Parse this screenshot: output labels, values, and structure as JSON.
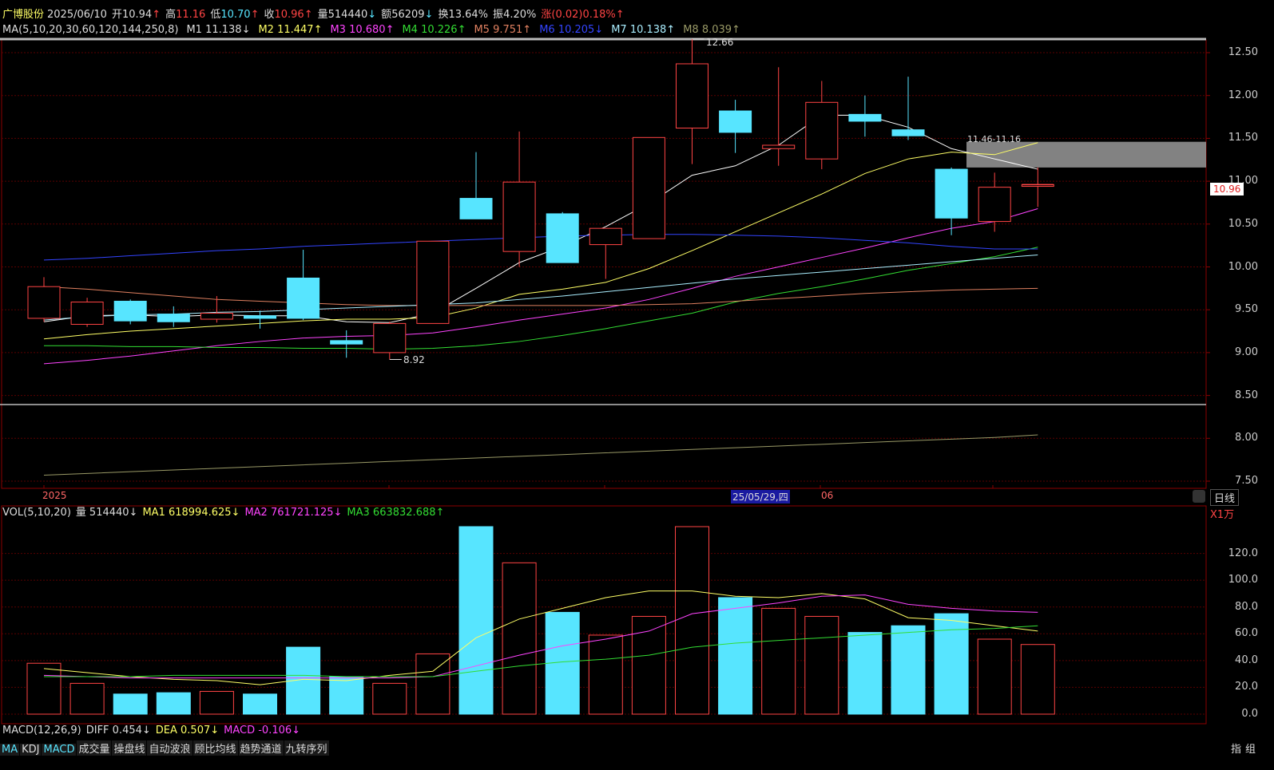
{
  "header": {
    "stock_name": "广博股份",
    "date": "2025/06/10",
    "open_label": "开",
    "open": "10.94",
    "open_arrow": "↑",
    "high_label": "高",
    "high": "11.16",
    "low_label": "低",
    "low": "10.70",
    "low_arrow": "↑",
    "close_label": "收",
    "close": "10.96",
    "close_arrow": "↑",
    "volume_label": "量",
    "volume": "514440",
    "volume_arrow": "↓",
    "amount_label": "额",
    "amount": "56209",
    "amount_arrow": "↓",
    "turnover_label": "换",
    "turnover": "13.64%",
    "amplitude_label": "振",
    "amplitude": "4.20%",
    "change_label": "涨",
    "change": "(0.02)",
    "change_pct": "0.18%",
    "change_arrow": "↑"
  },
  "ma_line": {
    "label": "MA(5,10,20,30,60,120,144,250,8)",
    "items": [
      {
        "name": "M1",
        "value": "11.138↓",
        "color": "#ffffff"
      },
      {
        "name": "M2",
        "value": "11.447↑",
        "color": "#ffff66"
      },
      {
        "name": "M3",
        "value": "10.680↑",
        "color": "#ff44ff"
      },
      {
        "name": "M4",
        "value": "10.226↑",
        "color": "#33dd33"
      },
      {
        "name": "M5",
        "value": "9.751↑",
        "color": "#e08060"
      },
      {
        "name": "M6",
        "value": "10.205↓",
        "color": "#3344ff"
      },
      {
        "name": "M7",
        "value": "10.138↑",
        "color": "#aaeeff"
      },
      {
        "name": "M8",
        "value": "8.039↑",
        "color": "#999966"
      }
    ]
  },
  "price_axis": [
    "12.50",
    "12.00",
    "11.50",
    "11.00",
    "10.50",
    "10.00",
    "9.50",
    "9.00",
    "8.50",
    "8.00",
    "7.50"
  ],
  "current_price_tag": "10.96",
  "annotations": {
    "high": "12.66",
    "low": "8.92",
    "zone": "11.46-11.16"
  },
  "date_labels": {
    "year": "2025",
    "cursor_date": "25/05/29,四",
    "month": "06"
  },
  "right_tools": {
    "period": "日线",
    "vol_unit": "X1万",
    "indicator": "指",
    "group": "组"
  },
  "vol_line": {
    "label": "VOL(5,10,20)",
    "vol_label": "量",
    "vol_value": "514440↓",
    "ma1": "MA1 618994.625↓",
    "ma2": "MA2 761721.125↓",
    "ma3": "MA3 663832.688↑"
  },
  "vol_axis": [
    "120.0",
    "100.0",
    "80.0",
    "60.0",
    "40.0",
    "20.0",
    "0.0"
  ],
  "macd_line": {
    "label": "MACD(12,26,9)",
    "diff": "DIFF 0.454↓",
    "dea": "DEA 0.507↓",
    "macd": "MACD -0.106↓"
  },
  "bottom_tabs": [
    "MA",
    "KDJ",
    "MACD",
    "成交量",
    "操盘线",
    "自动波浪",
    "顾比均线",
    "趋势通道",
    "九转序列"
  ],
  "colors": {
    "up": "#ff4444",
    "down": "#57e5ff",
    "grid": "#6b0000"
  },
  "chart_data": [
    {
      "type": "candlestick",
      "title": "",
      "ylim": [
        7.45,
        12.75
      ],
      "candles": [
        {
          "o": 9.4,
          "h": 9.88,
          "l": 9.36,
          "c": 9.77
        },
        {
          "o": 9.33,
          "h": 9.64,
          "l": 9.3,
          "c": 9.59
        },
        {
          "o": 9.6,
          "h": 9.62,
          "l": 9.33,
          "c": 9.37
        },
        {
          "o": 9.45,
          "h": 9.54,
          "l": 9.3,
          "c": 9.36
        },
        {
          "o": 9.39,
          "h": 9.66,
          "l": 9.35,
          "c": 9.46
        },
        {
          "o": 9.43,
          "h": 9.49,
          "l": 9.28,
          "c": 9.4
        },
        {
          "o": 9.87,
          "h": 10.2,
          "l": 9.38,
          "c": 9.4
        },
        {
          "o": 9.14,
          "h": 9.26,
          "l": 8.94,
          "c": 9.1
        },
        {
          "o": 9.0,
          "h": 9.36,
          "l": 8.92,
          "c": 9.34
        },
        {
          "o": 9.34,
          "h": 10.3,
          "l": 9.34,
          "c": 10.3
        },
        {
          "o": 10.8,
          "h": 11.34,
          "l": 10.8,
          "c": 10.56
        },
        {
          "o": 10.18,
          "h": 11.58,
          "l": 10.0,
          "c": 10.99
        },
        {
          "o": 10.62,
          "h": 10.64,
          "l": 10.05,
          "c": 10.05
        },
        {
          "o": 10.26,
          "h": 10.45,
          "l": 9.86,
          "c": 10.45
        },
        {
          "o": 10.33,
          "h": 11.51,
          "l": 10.33,
          "c": 11.51
        },
        {
          "o": 11.62,
          "h": 12.66,
          "l": 11.2,
          "c": 12.37
        },
        {
          "o": 11.82,
          "h": 11.95,
          "l": 11.33,
          "c": 11.57
        },
        {
          "o": 11.38,
          "h": 12.33,
          "l": 11.18,
          "c": 11.42
        },
        {
          "o": 11.26,
          "h": 12.17,
          "l": 11.14,
          "c": 11.92
        },
        {
          "o": 11.78,
          "h": 12.0,
          "l": 11.52,
          "c": 11.7
        },
        {
          "o": 11.6,
          "h": 12.22,
          "l": 11.48,
          "c": 11.53
        },
        {
          "o": 11.14,
          "h": 11.16,
          "l": 10.37,
          "c": 10.57
        },
        {
          "o": 10.53,
          "h": 11.1,
          "l": 10.41,
          "c": 10.93
        },
        {
          "o": 10.94,
          "h": 11.16,
          "l": 10.7,
          "c": 10.96
        }
      ],
      "ma_series": [
        {
          "name": "M1",
          "color": "#ffffff",
          "values": [
            9.36,
            9.43,
            9.44,
            9.42,
            9.44,
            9.43,
            9.43,
            9.36,
            9.35,
            9.46,
            9.75,
            10.05,
            10.24,
            10.47,
            10.74,
            11.07,
            11.18,
            11.42,
            11.77,
            11.77,
            11.63,
            11.38,
            11.26,
            11.14
          ]
        },
        {
          "name": "M2",
          "color": "#ffff66",
          "values": [
            9.16,
            9.21,
            9.25,
            9.28,
            9.31,
            9.34,
            9.37,
            9.39,
            9.39,
            9.41,
            9.52,
            9.68,
            9.74,
            9.82,
            9.98,
            10.19,
            10.41,
            10.63,
            10.85,
            11.09,
            11.26,
            11.34,
            11.31,
            11.45
          ]
        },
        {
          "name": "M3",
          "color": "#ff44ff",
          "values": [
            8.87,
            8.91,
            8.96,
            9.02,
            9.08,
            9.13,
            9.17,
            9.19,
            9.2,
            9.23,
            9.3,
            9.38,
            9.45,
            9.52,
            9.62,
            9.75,
            9.89,
            10.0,
            10.11,
            10.22,
            10.34,
            10.45,
            10.53,
            10.68
          ]
        },
        {
          "name": "M4",
          "color": "#33dd33",
          "values": [
            9.08,
            9.08,
            9.07,
            9.07,
            9.06,
            9.06,
            9.05,
            9.05,
            9.04,
            9.05,
            9.08,
            9.13,
            9.2,
            9.28,
            9.37,
            9.46,
            9.59,
            9.69,
            9.77,
            9.86,
            9.96,
            10.04,
            10.12,
            10.23
          ]
        },
        {
          "name": "M5",
          "color": "#e08060",
          "values": [
            9.77,
            9.74,
            9.7,
            9.66,
            9.62,
            9.6,
            9.58,
            9.56,
            9.55,
            9.55,
            9.55,
            9.55,
            9.55,
            9.55,
            9.56,
            9.57,
            9.6,
            9.63,
            9.66,
            9.69,
            9.71,
            9.73,
            9.74,
            9.75
          ]
        },
        {
          "name": "M6",
          "color": "#3344ff",
          "values": [
            10.08,
            10.1,
            10.13,
            10.16,
            10.19,
            10.21,
            10.24,
            10.26,
            10.28,
            10.3,
            10.32,
            10.34,
            10.36,
            10.37,
            10.38,
            10.38,
            10.37,
            10.36,
            10.34,
            10.31,
            10.28,
            10.24,
            10.21,
            10.21
          ]
        },
        {
          "name": "M7",
          "color": "#aaeeff",
          "values": [
            9.38,
            9.42,
            9.44,
            9.45,
            9.47,
            9.48,
            9.5,
            9.52,
            9.54,
            9.56,
            9.58,
            9.62,
            9.66,
            9.71,
            9.76,
            9.81,
            9.86,
            9.9,
            9.94,
            9.98,
            10.02,
            10.06,
            10.1,
            10.14
          ]
        },
        {
          "name": "M8",
          "color": "#999966",
          "values": [
            7.57,
            7.59,
            7.61,
            7.63,
            7.65,
            7.67,
            7.69,
            7.71,
            7.73,
            7.75,
            7.77,
            7.79,
            7.81,
            7.83,
            7.85,
            7.87,
            7.89,
            7.91,
            7.93,
            7.95,
            7.97,
            7.99,
            8.01,
            8.04
          ]
        }
      ]
    },
    {
      "type": "bar",
      "title": "",
      "ylim": [
        0,
        140
      ],
      "values": [
        38,
        23,
        15,
        16,
        17,
        15,
        50,
        28,
        23,
        45,
        140,
        113,
        76,
        59,
        73,
        140,
        87,
        79,
        73,
        61,
        66,
        75,
        56,
        52
      ],
      "ma_series": [
        {
          "name": "MA1",
          "color": "#ffff66",
          "values": [
            34,
            31,
            28,
            26,
            25,
            22,
            26,
            25,
            29,
            32,
            57,
            71,
            79,
            87,
            92,
            92,
            88,
            87,
            90,
            86,
            72,
            70,
            66,
            62
          ]
        },
        {
          "name": "MA2",
          "color": "#ff44ff",
          "values": [
            29,
            28,
            27,
            27,
            27,
            27,
            27,
            27,
            27,
            28,
            36,
            44,
            51,
            56,
            62,
            75,
            79,
            83,
            88,
            89,
            82,
            79,
            77,
            76
          ]
        },
        {
          "name": "MA3",
          "color": "#33dd33",
          "values": [
            28,
            28,
            28,
            29,
            29,
            29,
            29,
            28,
            28,
            28,
            32,
            36,
            39,
            41,
            44,
            50,
            53,
            55,
            57,
            59,
            61,
            63,
            64,
            66
          ]
        }
      ]
    }
  ]
}
